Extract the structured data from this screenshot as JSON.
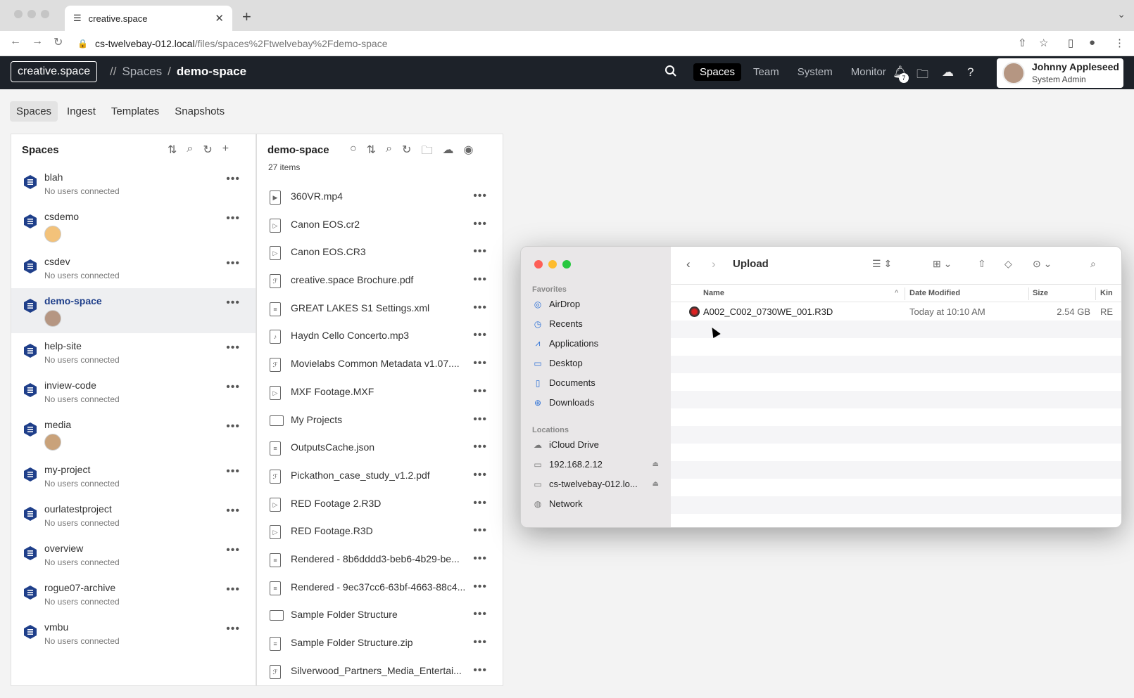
{
  "browser": {
    "tab_title": "creative.space",
    "url_host": "cs-twelvebay-012.local",
    "url_path": "/files/spaces%2Ftwelvebay%2Fdemo-space"
  },
  "header": {
    "logo": "creative.space",
    "sep1": "//",
    "crumb_spaces": "Spaces",
    "sep2": "/",
    "crumb_current": "demo-space",
    "nav": [
      "Spaces",
      "Team",
      "System",
      "Monitor"
    ],
    "notification_count": "7",
    "user_name": "Johnny Appleseed",
    "user_role": "System Admin"
  },
  "subnav": [
    "Spaces",
    "Ingest",
    "Templates",
    "Snapshots"
  ],
  "spaces_panel": {
    "title": "Spaces",
    "items": [
      {
        "name": "blah",
        "status": "No users connected"
      },
      {
        "name": "csdemo",
        "status": ""
      },
      {
        "name": "csdev",
        "status": "No users connected"
      },
      {
        "name": "demo-space",
        "status": ""
      },
      {
        "name": "help-site",
        "status": "No users connected"
      },
      {
        "name": "inview-code",
        "status": "No users connected"
      },
      {
        "name": "media",
        "status": ""
      },
      {
        "name": "my-project",
        "status": "No users connected"
      },
      {
        "name": "ourlatestproject",
        "status": "No users connected"
      },
      {
        "name": "overview",
        "status": "No users connected"
      },
      {
        "name": "rogue07-archive",
        "status": "No users connected"
      },
      {
        "name": "vmbu",
        "status": "No users connected"
      }
    ]
  },
  "files_panel": {
    "title": "demo-space",
    "count": "27 items",
    "items": [
      "360VR.mp4",
      "Canon EOS.cr2",
      "Canon EOS.CR3",
      "creative.space Brochure.pdf",
      "GREAT LAKES S1 Settings.xml",
      "Haydn Cello Concerto.mp3",
      "Movielabs Common Metadata v1.07....",
      "MXF Footage.MXF",
      "My Projects",
      "OutputsCache.json",
      "Pickathon_case_study_v1.2.pdf",
      "RED Footage 2.R3D",
      "RED Footage.R3D",
      "Rendered - 8b6dddd3-beb6-4b29-be...",
      "Rendered - 9ec37cc6-63bf-4663-88c4...",
      "Sample Folder Structure",
      "Sample Folder Structure.zip",
      "Silverwood_Partners_Media_Entertai..."
    ]
  },
  "finder": {
    "title": "Upload",
    "favorites_label": "Favorites",
    "favorites": [
      "AirDrop",
      "Recents",
      "Applications",
      "Desktop",
      "Documents",
      "Downloads"
    ],
    "locations_label": "Locations",
    "locations": [
      "iCloud Drive",
      "192.168.2.12",
      "cs-twelvebay-012.lo...",
      "Network"
    ],
    "columns": {
      "name": "Name",
      "date": "Date Modified",
      "size": "Size",
      "kind": "Kin"
    },
    "rows": [
      {
        "name": "A002_C002_0730WE_001.R3D",
        "date": "Today at 10:10 AM",
        "size": "2.54 GB",
        "kind": "RE"
      }
    ]
  }
}
